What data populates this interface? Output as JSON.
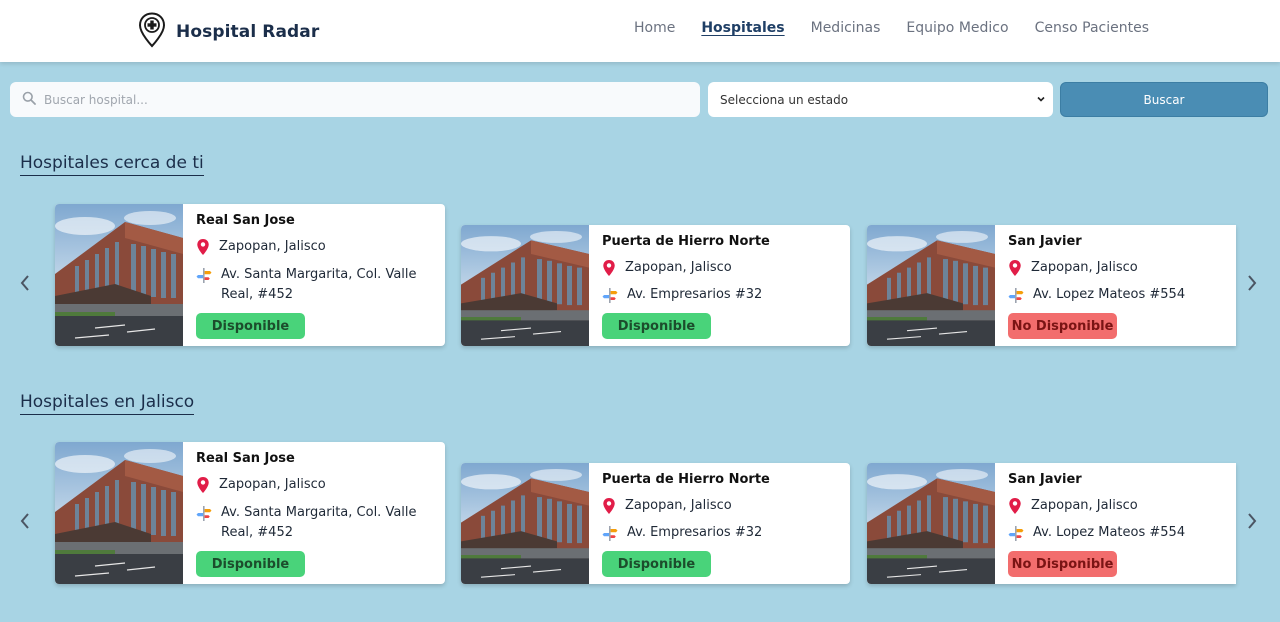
{
  "brand": {
    "name": "Hospital Radar"
  },
  "nav": {
    "items": [
      {
        "label": "Home",
        "active": false
      },
      {
        "label": "Hospitales",
        "active": true
      },
      {
        "label": "Medicinas",
        "active": false
      },
      {
        "label": "Equipo Medico",
        "active": false
      },
      {
        "label": "Censo Pacientes",
        "active": false
      }
    ]
  },
  "search": {
    "placeholder": "Buscar hospital...",
    "value": "",
    "state_selected": "Selecciona un estado",
    "button_label": "Buscar"
  },
  "colors": {
    "page_bg": "#a8d4e4",
    "accent_button": "#4a8db4",
    "available": "#49d37a",
    "unavailable": "#f26d6d",
    "pin": "#e11d48"
  },
  "sections": [
    {
      "title": "Hospitales cerca de ti",
      "cards": [
        {
          "name": "Real San Jose",
          "location": "Zapopan, Jalisco",
          "address": "Av. Santa Margarita, Col. Valle Real, #452",
          "status": "Disponible"
        },
        {
          "name": "Puerta de Hierro Norte",
          "location": "Zapopan, Jalisco",
          "address": "Av. Empresarios #32",
          "status": "Disponible"
        },
        {
          "name": "San Javier",
          "location": "Zapopan, Jalisco",
          "address": "Av. Lopez Mateos #554",
          "status": "No Disponible"
        }
      ]
    },
    {
      "title": "Hospitales en Jalisco",
      "cards": [
        {
          "name": "Real San Jose",
          "location": "Zapopan, Jalisco",
          "address": "Av. Santa Margarita, Col. Valle Real, #452",
          "status": "Disponible"
        },
        {
          "name": "Puerta de Hierro Norte",
          "location": "Zapopan, Jalisco",
          "address": "Av. Empresarios #32",
          "status": "Disponible"
        },
        {
          "name": "San Javier",
          "location": "Zapopan, Jalisco",
          "address": "Av. Lopez Mateos #554",
          "status": "No Disponible"
        }
      ]
    }
  ]
}
